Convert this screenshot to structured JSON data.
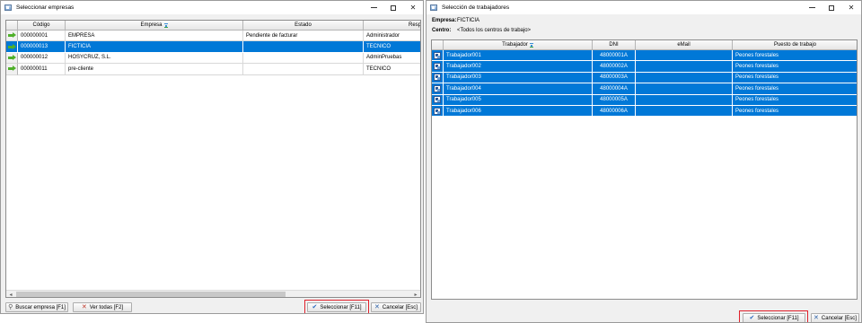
{
  "left_window": {
    "title": "Seleccionar empresas",
    "columns": [
      "Código",
      "Empresa",
      "Estado",
      "Resp"
    ],
    "rows": [
      {
        "codigo": "000000001",
        "empresa": "EMPRESA",
        "estado": "Pendiente de facturar",
        "resp": "Administrador",
        "selected": false
      },
      {
        "codigo": "000000013",
        "empresa": "FICTICIA",
        "estado": "",
        "resp": "TECNICO",
        "selected": true
      },
      {
        "codigo": "000000012",
        "empresa": "HOSYCRUZ, S.L.",
        "estado": "",
        "resp": "AdminPruebas",
        "selected": false
      },
      {
        "codigo": "000000011",
        "empresa": "pre-cliente",
        "estado": "",
        "resp": "TECNICO",
        "selected": false
      }
    ],
    "buttons": {
      "search": "Buscar empresa  [F1]",
      "view_all": "Ver todas  [F2]",
      "select": "Seleccionar  [F11]",
      "cancel": "Cancelar  [Esc]"
    }
  },
  "right_window": {
    "title": "Selección de trabajadores",
    "empresa_label": "Empresa:",
    "empresa_value": "FICTICIA",
    "centro_label": "Centro:",
    "centro_value": "<Todos los centros de trabajo>",
    "columns": [
      "Trabajador",
      "DNI",
      "eMail",
      "Puesto de trabajo"
    ],
    "rows": [
      {
        "trabajador": "Trabajador001",
        "dni": "48000001A",
        "email": "",
        "puesto": "Peones forestales"
      },
      {
        "trabajador": "Trabajador002",
        "dni": "48000002A",
        "email": "",
        "puesto": "Peones forestales"
      },
      {
        "trabajador": "Trabajador003",
        "dni": "48000003A",
        "email": "",
        "puesto": "Peones forestales"
      },
      {
        "trabajador": "Trabajador004",
        "dni": "48000004A",
        "email": "",
        "puesto": "Peones forestales"
      },
      {
        "trabajador": "Trabajador005",
        "dni": "48000005A",
        "email": "",
        "puesto": "Peones forestales"
      },
      {
        "trabajador": "Trabajador006",
        "dni": "48000006A",
        "email": "",
        "puesto": "Peones forestales"
      }
    ],
    "buttons": {
      "select": "Seleccionar  [F11]",
      "cancel": "Cancelar  [Esc]"
    }
  },
  "colors": {
    "selection": "#0078d7",
    "highlight": "#e0202a",
    "arrow": "#4fb02a"
  }
}
